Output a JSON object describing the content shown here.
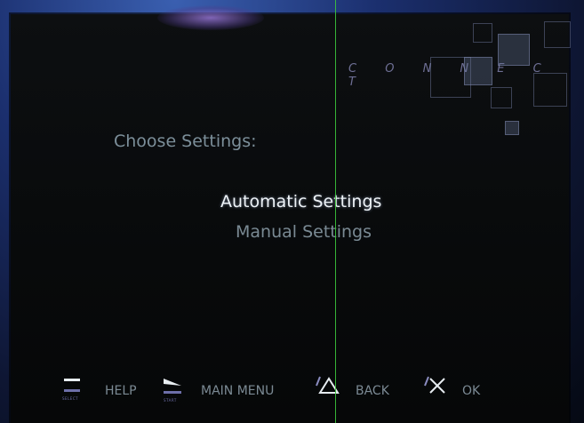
{
  "brand": {
    "text": "C O N N E C T"
  },
  "screen": {
    "heading": "Choose Settings:"
  },
  "menu": {
    "items": [
      {
        "label": "Automatic Settings",
        "selected": true
      },
      {
        "label": "Manual Settings",
        "selected": false
      }
    ]
  },
  "footer": {
    "help": {
      "button_caption": "SELECT",
      "label": "HELP"
    },
    "main_menu": {
      "button_caption": "START",
      "label": "MAIN MENU"
    },
    "back": {
      "button_icon": "triangle-icon",
      "label": "BACK"
    },
    "ok": {
      "button_icon": "cross-icon",
      "label": "OK"
    }
  },
  "colors": {
    "selected_text": "#eef3f7",
    "unselected_text": "#7a8a94",
    "icon_accent": "#6d6fa8"
  }
}
